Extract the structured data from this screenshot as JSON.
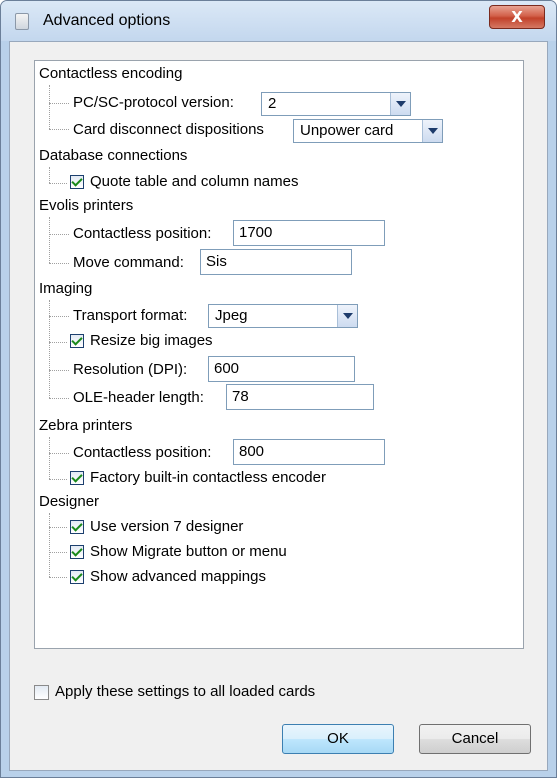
{
  "window": {
    "title": "Advanced options",
    "close_glyph": "X"
  },
  "tree": {
    "contactless_encoding": {
      "heading": "Contactless encoding",
      "protocol_label": "PC/SC-protocol version:",
      "protocol_value": "2",
      "disconnect_label": "Card disconnect dispositions",
      "disconnect_value": "Unpower card"
    },
    "database_connections": {
      "heading": "Database connections",
      "quote_label": "Quote table and column names",
      "quote_checked": true
    },
    "evolis_printers": {
      "heading": "Evolis printers",
      "position_label": "Contactless position:",
      "position_value": "1700",
      "move_label": "Move command:",
      "move_value": "Sis"
    },
    "imaging": {
      "heading": "Imaging",
      "transport_label": "Transport format:",
      "transport_value": "Jpeg",
      "resize_label": "Resize big images",
      "resize_checked": true,
      "resolution_label": "Resolution (DPI):",
      "resolution_value": "600",
      "ole_label": "OLE-header length:",
      "ole_value": "78"
    },
    "zebra_printers": {
      "heading": "Zebra printers",
      "position_label": "Contactless position:",
      "position_value": "800",
      "factory_label": "Factory built-in contactless encoder",
      "factory_checked": true
    },
    "designer": {
      "heading": "Designer",
      "v7_label": "Use version 7 designer",
      "v7_checked": true,
      "migrate_label": "Show Migrate button or menu",
      "migrate_checked": true,
      "mappings_label": "Show advanced mappings",
      "mappings_checked": true
    }
  },
  "footer": {
    "apply_all_label": "Apply these settings to all loaded cards",
    "apply_all_checked": false,
    "ok_label": "OK",
    "cancel_label": "Cancel"
  },
  "colors": {
    "frame": "#b9d1ea",
    "close_button": "#c2412a",
    "check": "#1a8a1a"
  }
}
